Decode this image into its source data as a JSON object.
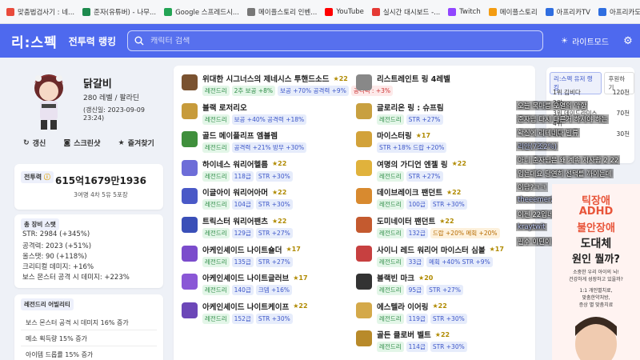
{
  "bookmarks": [
    {
      "label": "맞춤법검사기 : 네...",
      "color": "#e94b3c"
    },
    {
      "label": "준자(유튜버) - 나무...",
      "color": "#1d8a4e"
    },
    {
      "label": "Google 스프레드시...",
      "color": "#23a455"
    },
    {
      "label": "메이플스토리 인벤...",
      "color": "#777777"
    },
    {
      "label": "YouTube",
      "color": "#ff0000"
    },
    {
      "label": "실시간 대시보드 -...",
      "color": "#e53935"
    },
    {
      "label": "Twitch",
      "color": "#9146ff"
    },
    {
      "label": "메이플스토리",
      "color": "#f39c12"
    },
    {
      "label": "아프리카TV",
      "color": "#2f6ee0"
    },
    {
      "label": "아프리카도우미 스...",
      "color": "#2f6ee0"
    }
  ],
  "header": {
    "logo": "리:스펙",
    "nav": "전투력 랭킹",
    "search_placeholder": "캐릭터 검색",
    "light_mode": "라이트모드"
  },
  "profile": {
    "name": "닭갈비",
    "level": "280 레벨 / 팔라딘",
    "updated": "(갱신일: 2023-09-09 23:24)",
    "btn_refresh": "갱신",
    "btn_screenshot": "스크린샷",
    "btn_favorite": "즐겨찾기"
  },
  "power": {
    "label": "전투력",
    "value": "615억1679만1936",
    "sub": "3여명 4차 5유 5포장"
  },
  "stats": {
    "header": "총 장비 스탯",
    "lines": [
      "STR: 2984 (+345%)",
      "공격력: 2023 (+51%)",
      "올스탯: 90 (+118%)",
      "크리티컬 데미지: +16%",
      "보스 몬스터 공격 시 데미지: +223%"
    ]
  },
  "legendary": {
    "header": "레전드리 어빌리티",
    "lines": [
      "보스 몬스터 공격 시 데미지 16% 증가",
      "메소 획득량 15% 증가",
      "아이템 드롭률 15% 증가"
    ]
  },
  "items_left": [
    {
      "name": "위대한 시그너스의 제네시스 투핸드소드",
      "star": "★22",
      "color": "#7a5230",
      "tags": [
        [
          "레전드리",
          "t1"
        ],
        [
          "2추 보공 +8%",
          "t1"
        ],
        [
          "보공 +70% 공격력 +9%",
          "t2"
        ],
        [
          "공격력 : +3%",
          "t3"
        ]
      ]
    },
    {
      "name": "블랙 로저리오",
      "star": "",
      "color": "#c79b3b",
      "tags": [
        [
          "레전드리",
          "t1"
        ],
        [
          "보공 +40% 공격력 +18%",
          "t2"
        ]
      ]
    },
    {
      "name": "골드 메이플리프 엠블렘",
      "star": "",
      "color": "#3f8f3c",
      "tags": [
        [
          "레전드리",
          "t1"
        ],
        [
          "공격력 +21% 방무 +30%",
          "t2"
        ]
      ]
    },
    {
      "name": "하이네스 워리어헬름",
      "star": "★22",
      "color": "#6d6dd8",
      "tags": [
        [
          "레전드리",
          "t1"
        ],
        [
          "118급",
          "t2"
        ],
        [
          "STR +30%",
          "t2"
        ]
      ]
    },
    {
      "name": "이글아이 워리어아머",
      "star": "★22",
      "color": "#4a59c7",
      "tags": [
        [
          "레전드리",
          "t1"
        ],
        [
          "104급",
          "t2"
        ],
        [
          "STR +30%",
          "t2"
        ]
      ]
    },
    {
      "name": "트릭스터 워리어팬츠",
      "star": "★22",
      "color": "#3a4fb8",
      "tags": [
        [
          "레전드리",
          "t1"
        ],
        [
          "129급",
          "t2"
        ],
        [
          "STR +27%",
          "t2"
        ]
      ]
    },
    {
      "name": "아케인셰이드 나이트숄더",
      "star": "★17",
      "color": "#7b4ccc",
      "tags": [
        [
          "레전드리",
          "t1"
        ],
        [
          "135급",
          "t2"
        ],
        [
          "STR +27%",
          "t2"
        ]
      ]
    },
    {
      "name": "아케인셰이드 나이트글러브",
      "star": "★17",
      "color": "#8a57d6",
      "tags": [
        [
          "레전드리",
          "t1"
        ],
        [
          "140급",
          "t2"
        ],
        [
          "크뎀 +16%",
          "t2"
        ]
      ]
    },
    {
      "name": "아케인셰이드 나이트케이프",
      "star": "★22",
      "color": "#6c47b8",
      "tags": [
        [
          "레전드리",
          "t1"
        ],
        [
          "152급",
          "t2"
        ],
        [
          "STR +30%",
          "t2"
        ]
      ]
    }
  ],
  "items_right": [
    {
      "name": "리스트레인트 링 4레벨",
      "star": "",
      "color": "#888888",
      "tags": []
    },
    {
      "name": "글로리온 링 : 슈프림",
      "star": "",
      "color": "#c8a040",
      "tags": [
        [
          "레전드리",
          "t1"
        ],
        [
          "STR +27%",
          "t2"
        ]
      ]
    },
    {
      "name": "마이스터링",
      "star": "★17",
      "color": "#d2a23a",
      "tags": [
        [
          "STR +18% 드랍 +20%",
          "t2"
        ]
      ]
    },
    {
      "name": "여명의 가디언 엔젤 링",
      "star": "★22",
      "color": "#e0b23c",
      "tags": [
        [
          "레전드리",
          "t1"
        ],
        [
          "STR +27%",
          "t2"
        ]
      ]
    },
    {
      "name": "데이브레이크 팬던트",
      "star": "★22",
      "color": "#d88a2f",
      "tags": [
        [
          "레전드리",
          "t1"
        ],
        [
          "100급",
          "t2"
        ],
        [
          "STR +30%",
          "t2"
        ]
      ]
    },
    {
      "name": "도미네이터 팬던트",
      "star": "★22",
      "color": "#c45a2f",
      "tags": [
        [
          "레전드리",
          "t1"
        ],
        [
          "132급",
          "t2"
        ],
        [
          "드랍 +20% 메획 +20%",
          "t4"
        ]
      ]
    },
    {
      "name": "사이니 레드 워리어 마이스터 심볼",
      "star": "★17",
      "color": "#c74040",
      "tags": [
        [
          "레전드리",
          "t1"
        ],
        [
          "33급",
          "t2"
        ],
        [
          "메획 +40% STR +9%",
          "t2"
        ]
      ]
    },
    {
      "name": "블랙빈 마크",
      "star": "★20",
      "color": "#333333",
      "tags": [
        [
          "레전드리",
          "t1"
        ],
        [
          "95급",
          "t2"
        ],
        [
          "STR +27%",
          "t2"
        ]
      ]
    },
    {
      "name": "에스텔라 이어링",
      "star": "★22",
      "color": "#d4a94a",
      "tags": [
        [
          "레전드리",
          "t1"
        ],
        [
          "119급",
          "t2"
        ],
        [
          "STR +30%",
          "t2"
        ]
      ]
    },
    {
      "name": "골든 클로버 벨트",
      "star": "★22",
      "color": "#b88a2a",
      "tags": [
        [
          "레전드리",
          "t1"
        ],
        [
          "114급",
          "t2"
        ],
        [
          "STR +30%",
          "t2"
        ]
      ]
    }
  ],
  "ranking": {
    "tab1": "리:스펙 유저 랭킹",
    "tab2": "후원하기",
    "rows": [
      "1위 김비다",
      "2위",
      "3위 데이드라미스",
      "4위",
      "5위"
    ],
    "vals": [
      "120천",
      "",
      "70천",
      "",
      "30천"
    ]
  },
  "chat": [
    {
      "user": "",
      "text": "오늘 목마름 오열의 막함"
    },
    {
      "user": "",
      "text": "준자님 다시 다른거 하셔야 하는"
    },
    {
      "user": "",
      "text": "확실에 리테네다 빌류"
    },
    {
      "user": "리안(7조2%)",
      "text": ""
    },
    {
      "user": "",
      "text": "아니 준자님은 왜 계속 저사람 2 22"
    },
    {
      "user": "",
      "text": "입는데요 당연히 선택를 까이는데"
    },
    {
      "user": "",
      "text": "이남?ㅋㅋ"
    },
    {
      "user": "theeemer234",
      "text": ""
    },
    {
      "user": "",
      "text": "이젠 22입네"
    },
    {
      "user": "kraytwit",
      "text": ""
    },
    {
      "user": "",
      "text": "필수 이딘이"
    }
  ],
  "ad": {
    "l1": "틱장애",
    "l2": "ADHD",
    "l3": "불안장애",
    "l4": "도대체",
    "l5": "원인 뭘까?",
    "s1": "소중한 우리 아이의 뇌!",
    "s2": "건강하게 성장하고 있을까?",
    "s3": "1:1 개인별치료,",
    "s4": "맞춤한약처방,",
    "s5": "증상 별 맞춤치료"
  }
}
